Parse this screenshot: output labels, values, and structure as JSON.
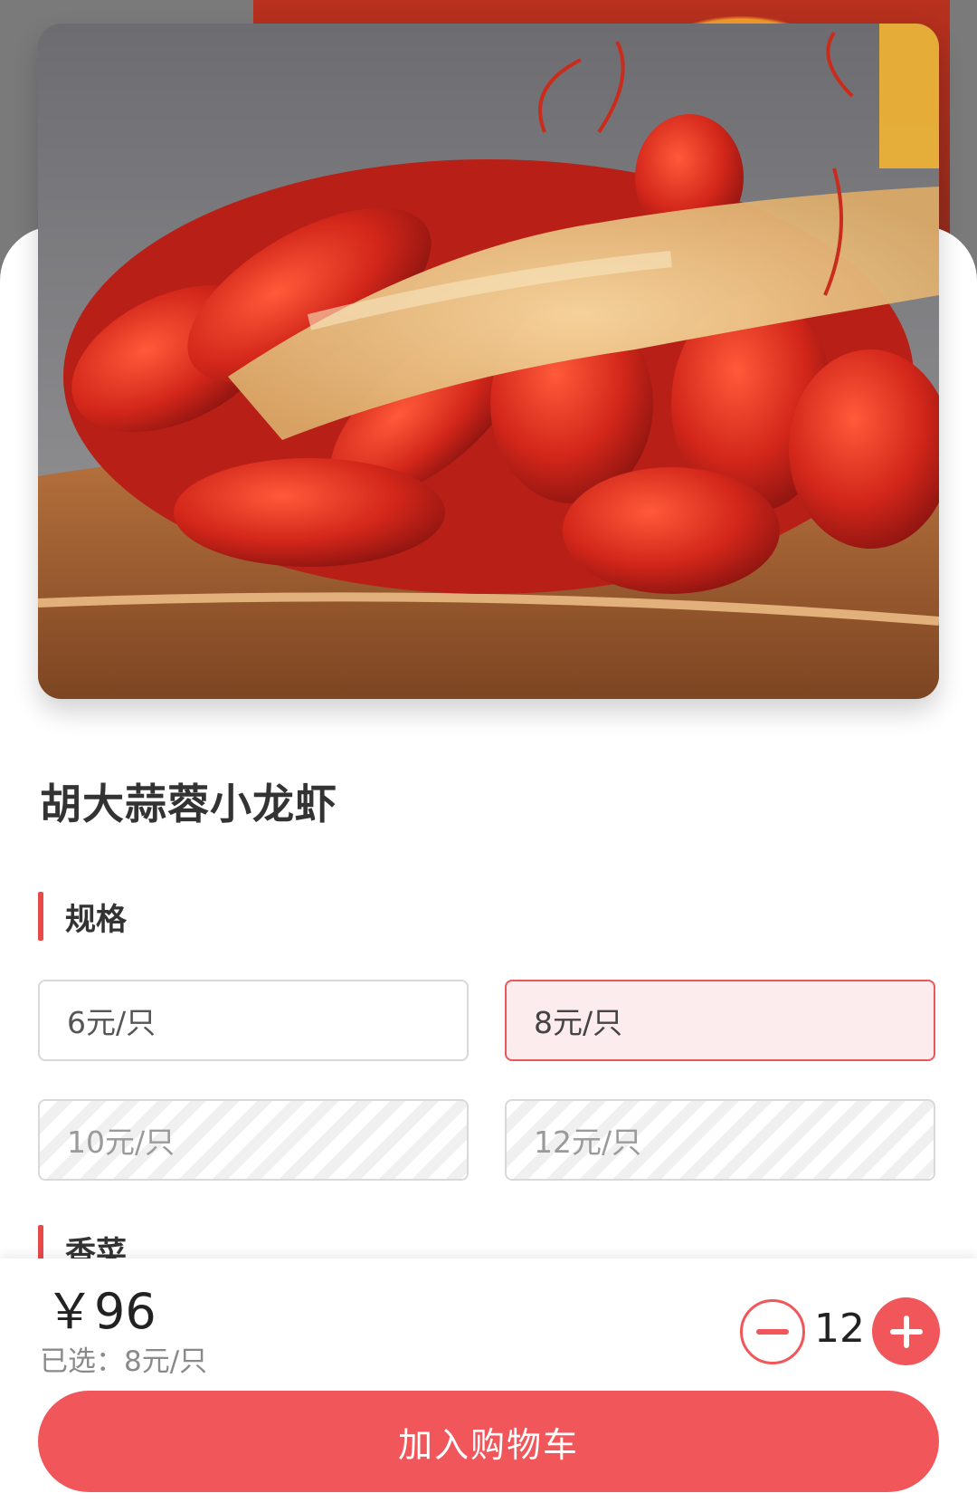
{
  "product": {
    "title": "胡大蒜蓉小龙虾"
  },
  "spec_section": {
    "label": "规格",
    "options": [
      {
        "label": "6元/只",
        "state": "normal"
      },
      {
        "label": "8元/只",
        "state": "selected"
      },
      {
        "label": "10元/只",
        "state": "disabled"
      },
      {
        "label": "12元/只",
        "state": "disabled"
      }
    ]
  },
  "cilantro_section": {
    "label": "香菜"
  },
  "cart_bar": {
    "price": "￥96",
    "selected_summary": "已选：8元/只",
    "quantity": "12",
    "add_to_cart_label": "加入购物车"
  },
  "colors": {
    "accent": "#f1565a",
    "selected_bg": "#fdeced",
    "section_bar": "#e84a4a"
  },
  "icons": [
    "minus-icon",
    "plus-icon"
  ]
}
